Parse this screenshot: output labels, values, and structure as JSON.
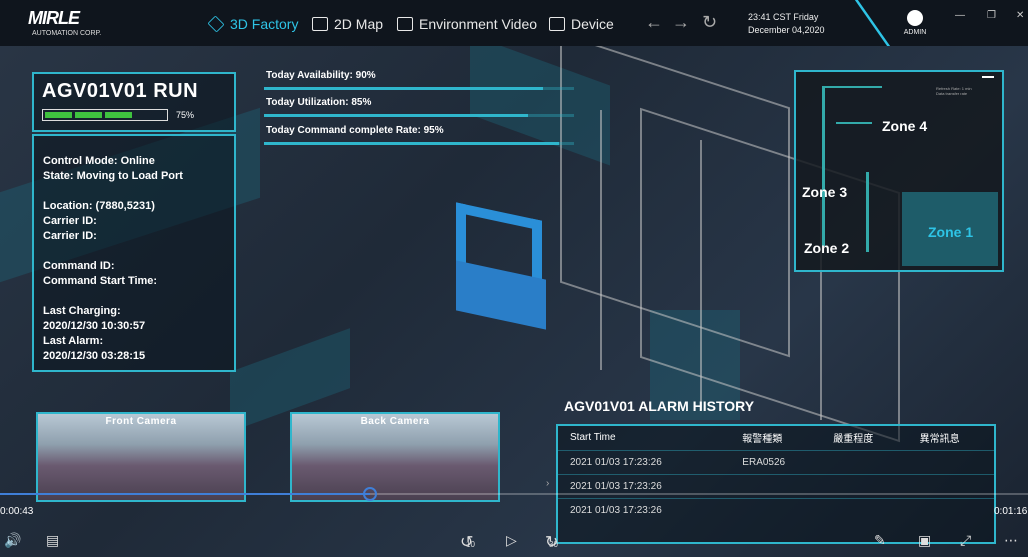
{
  "nav": {
    "logo_main": "MIRLE",
    "logo_sub": "AUTOMATION CORP.",
    "tabs": [
      {
        "label": "3D Factory"
      },
      {
        "label": "2D Map"
      },
      {
        "label": "Environment Video"
      },
      {
        "label": "Device"
      }
    ],
    "clock_time": "23:41 CST  Friday",
    "clock_date": "December 04,2020",
    "user": "ADMIN"
  },
  "agv": {
    "title": "AGV01V01  RUN",
    "battery_percent": 0.75,
    "battery_label": "75%",
    "control_mode": "Control Mode: Online",
    "state": "State: Moving to Load Port",
    "location": "Location: (7880,5231)",
    "carrier1": "Carrier ID:",
    "carrier2": "Carrier ID:",
    "command_id": "Command ID:",
    "command_start": "Command Start Time:",
    "last_charging_label": "Last Charging:",
    "last_charging": "2020/12/30 10:30:57",
    "last_alarm_label": "Last Alarm:",
    "last_alarm": "2020/12/30 03:28:15"
  },
  "stats": [
    {
      "label": "Today Availability: 90%",
      "value": 0.9
    },
    {
      "label": "Today Utilization: 85%",
      "value": 0.85
    },
    {
      "label": "Today Command complete Rate: 95%",
      "value": 0.95
    }
  ],
  "minimap": {
    "zones": [
      "Zone 4",
      "Zone 3",
      "Zone 2",
      "Zone 1"
    ],
    "legend1": "Refresh Rate: 1 min",
    "legend2": "Data transfer rate"
  },
  "cameras": {
    "front": "Front Camera",
    "back": "Back Camera"
  },
  "alarm": {
    "title": "AGV01V01 ALARM HISTORY",
    "headers": [
      "Start Time",
      "報警種類",
      "嚴重程度",
      "異常訊息"
    ],
    "rows": [
      [
        "2021 01/03 17:23:26",
        "ERA0526",
        "",
        ""
      ],
      [
        "2021 01/03 17:23:26",
        "",
        "",
        ""
      ],
      [
        "2021 01/03 17:23:26",
        "",
        "",
        ""
      ]
    ]
  },
  "video": {
    "elapsed": "0:00:43",
    "total": "0:01:16",
    "progress": 0.36,
    "skip_back": "10",
    "skip_fwd": "30"
  }
}
